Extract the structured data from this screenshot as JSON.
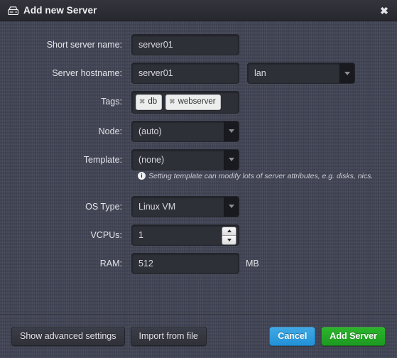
{
  "titlebar": {
    "icon": "server-icon",
    "title": "Add new Server",
    "close_label": "✖"
  },
  "form": {
    "short_name": {
      "label": "Short server name:",
      "value": "server01",
      "placeholder": ""
    },
    "hostname": {
      "label": "Server hostname:",
      "value": "server01",
      "placeholder": "",
      "domain": {
        "value": "lan",
        "options": [
          "lan"
        ]
      }
    },
    "tags": {
      "label": "Tags:",
      "items": [
        {
          "label": "db",
          "remove_icon": "✖"
        },
        {
          "label": "webserver",
          "remove_icon": "✖"
        }
      ]
    },
    "node": {
      "label": "Node:",
      "value": "(auto)",
      "options": [
        "(auto)"
      ]
    },
    "template": {
      "label": "Template:",
      "value": "(none)",
      "options": [
        "(none)"
      ],
      "hint": "Setting template can modify lots of server attributes, e.g. disks, nics.",
      "hint_icon": "i"
    },
    "os_type": {
      "label": "OS Type:",
      "value": "Linux VM",
      "options": [
        "Linux VM"
      ]
    },
    "vcpus": {
      "label": "VCPUs:",
      "value": "1",
      "placeholder": ""
    },
    "ram": {
      "label": "RAM:",
      "value": "512",
      "placeholder": "",
      "unit": "MB"
    }
  },
  "footer": {
    "show_advanced": "Show advanced settings",
    "import_from_file": "Import from file",
    "cancel": "Cancel",
    "submit": "Add Server"
  },
  "colors": {
    "background": "#414454",
    "titlebar": "#2e2e36",
    "field": "#2e3038",
    "accent_blue": "#2391d6",
    "accent_green": "#1e9a22",
    "tag_chip": "#eceded"
  }
}
